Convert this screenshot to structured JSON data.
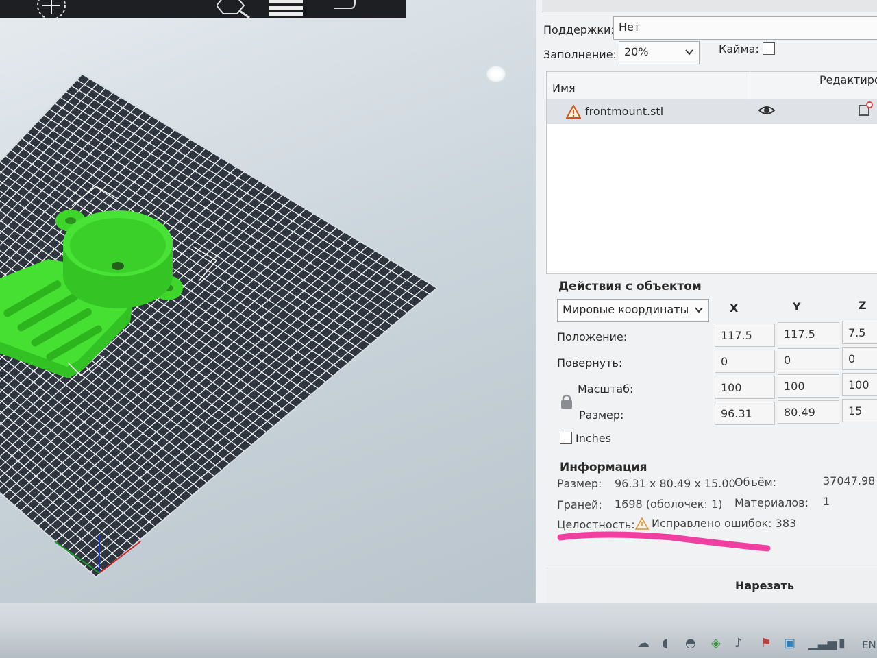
{
  "toolbar": {
    "icons": [
      "add-icon",
      "search-icon",
      "menu-icon",
      "undo-icon"
    ]
  },
  "panel": {
    "supports_label": "Поддержки:",
    "supports_value": "Нет",
    "infill_label": "Заполнение:",
    "infill_value": "20%",
    "brim_label": "Кайма:",
    "brim_checked": false,
    "objects_header_name": "Имя",
    "objects_header_edit": "Редактиро",
    "object_name": "frontmount.stl",
    "object_warning_icon": "warning-icon",
    "object_visible_icon": "eye-icon",
    "object_edit_icon": "edit-icon"
  },
  "actions": {
    "title": "Действия с объектом",
    "coord_system": "Мировые координаты",
    "col_x": "X",
    "col_y": "Y",
    "col_z": "Z",
    "position_label": "Положение:",
    "position": [
      "117.5",
      "117.5",
      "7.5"
    ],
    "rotate_label": "Повернуть:",
    "rotate": [
      "0",
      "0",
      "0"
    ],
    "scale_label": "Масштаб:",
    "scale": [
      "100",
      "100",
      "100"
    ],
    "size_label": "Размер:",
    "size": [
      "96.31",
      "80.49",
      "15"
    ],
    "lock_icon": "lock-icon",
    "inches_label": "Inches",
    "inches_checked": false
  },
  "info": {
    "title": "Информация",
    "size_label": "Размер:",
    "size_value": "96.31 x 80.49 x 15.00",
    "volume_label": "Объём:",
    "volume_value": "37047.98",
    "facets_label": "Граней:",
    "facets_value": "1698 (оболочек: 1)",
    "materials_label": "Материалов:",
    "materials_value": "1",
    "integrity_label": "Целостность:",
    "integrity_value": "Исправлено ошибок: 383"
  },
  "slice_button": "Нарезать",
  "colors": {
    "model": "#3fd62b",
    "bed_grid": "#f2f4f6",
    "bed_dark": "#353b44",
    "highlight": "#ef3fa0"
  },
  "taskbar": {
    "language": "EN",
    "tray_icons": [
      "cloud-icon",
      "speaker-icon",
      "network-icon",
      "shield-icon",
      "volume-icon",
      "flag-icon",
      "app-icon",
      "signal-icon",
      "battery-icon"
    ]
  }
}
